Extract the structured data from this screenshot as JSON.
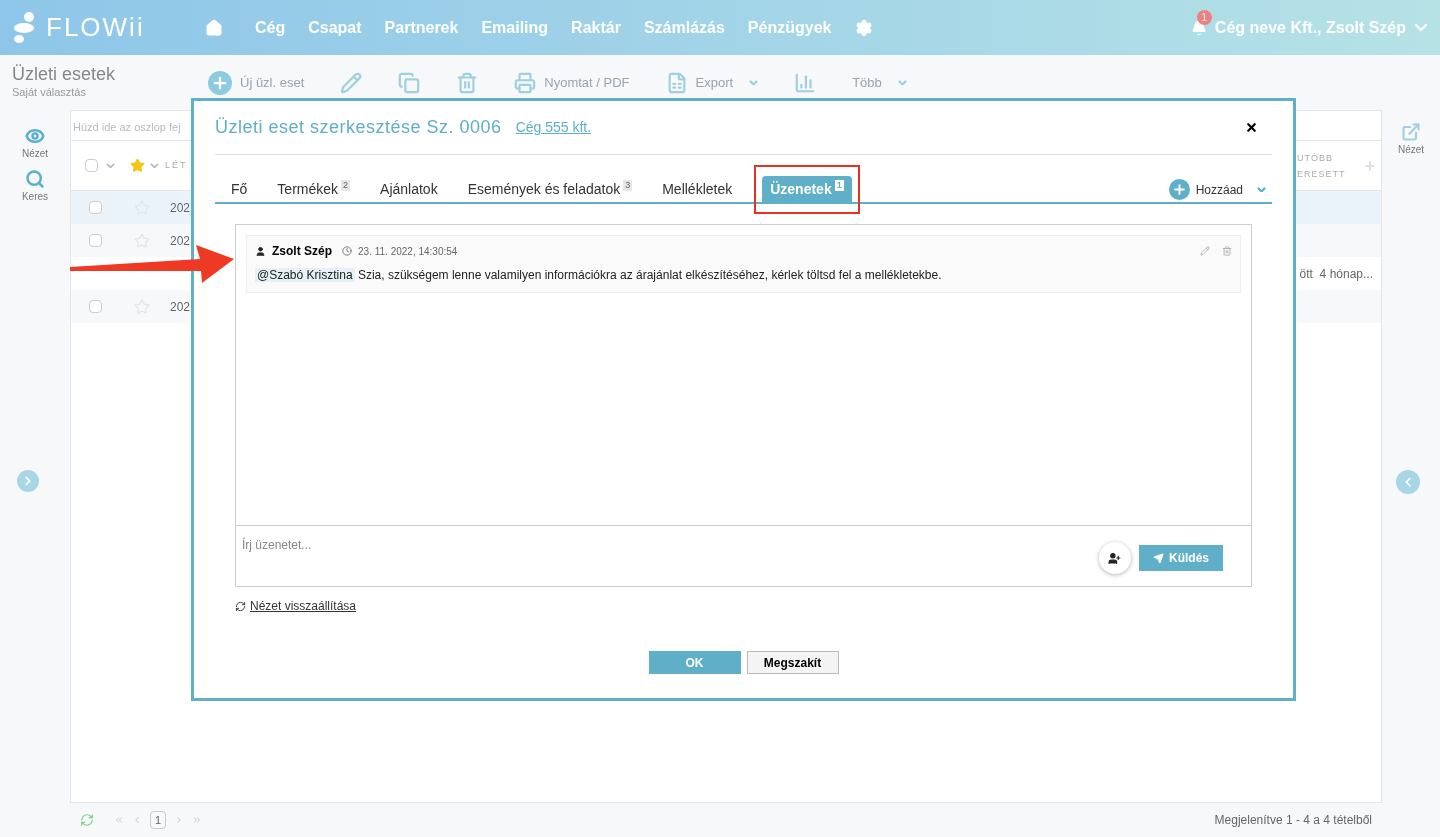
{
  "brand": "FLOWii",
  "nav": [
    "Cég",
    "Csapat",
    "Partnerek",
    "Emailing",
    "Raktár",
    "Számlázás",
    "Pénzügyek"
  ],
  "notifications": "1",
  "account": "Cég neve Kft., Zsolt Szép",
  "page": {
    "title": "Üzleti esetek",
    "subtitle": "Saját választás"
  },
  "toolbar": [
    {
      "kind": "add",
      "label": "Új üzl. eset"
    },
    {
      "kind": "edit"
    },
    {
      "kind": "copy"
    },
    {
      "kind": "delete"
    },
    {
      "kind": "print",
      "label": "Nyomtat / PDF"
    },
    {
      "kind": "export",
      "label": "Export",
      "dropdown": true
    },
    {
      "kind": "chart"
    },
    {
      "kind": "more",
      "label": "Több",
      "dropdown": true
    }
  ],
  "left_rail": [
    {
      "kind": "view",
      "label": "Nézet"
    },
    {
      "kind": "search",
      "label": "Keres"
    }
  ],
  "right_rail": {
    "label": "Nézet"
  },
  "grid": {
    "group_hint": "Húzd ide az oszlop fej",
    "header_checked": false,
    "column_1": "LÉT",
    "column_last": "UTÓBB ERESETT",
    "rows": [
      {
        "selected": true,
        "checked": false,
        "starred": false,
        "cell_1": "202"
      },
      {
        "selected": false,
        "checked": false,
        "starred": false,
        "cell_1": "202"
      },
      {
        "selected": false,
        "cell_last": "ött  4 hónap..."
      },
      {
        "selected": false,
        "checked": false,
        "starred": false,
        "cell_1": "202"
      }
    ]
  },
  "pager": {
    "page": "1",
    "summary": "Megjelenítve 1 - 4 a 4 tételből"
  },
  "modal": {
    "title": "Üzleti eset szerkesztése Sz. 0006",
    "link": "Cég 555 kft.",
    "tabs": [
      {
        "label": "Fő",
        "selected": false,
        "highlight": false
      },
      {
        "label": "Termékek",
        "count": "2",
        "selected": false,
        "highlight": false
      },
      {
        "label": "Ajánlatok",
        "selected": false,
        "highlight": false
      },
      {
        "label": "Események és feladatok",
        "count": "3",
        "selected": false,
        "highlight": false
      },
      {
        "label": "Mellékletek",
        "selected": false,
        "highlight": false
      },
      {
        "label": "Üzenetek",
        "count": "1",
        "selected": true,
        "highlight": true
      }
    ],
    "add_button": "Hozzáad",
    "messages": [
      {
        "author": "Zsolt Szép",
        "time": "23. 11. 2022, 14:30:54",
        "mention": "@Szabó Krisztina",
        "text": "Szia, szükségem lenne valamilyen információkra az árajánlat elkészítéséhez, kérlek töltsd fel a mellékletekbe."
      }
    ],
    "composer": {
      "placeholder": "Írj üzenetet...",
      "send": "Küldés"
    },
    "reset_link": "Nézet visszaállítása",
    "ok": "OK",
    "cancel": "Megszakít"
  }
}
